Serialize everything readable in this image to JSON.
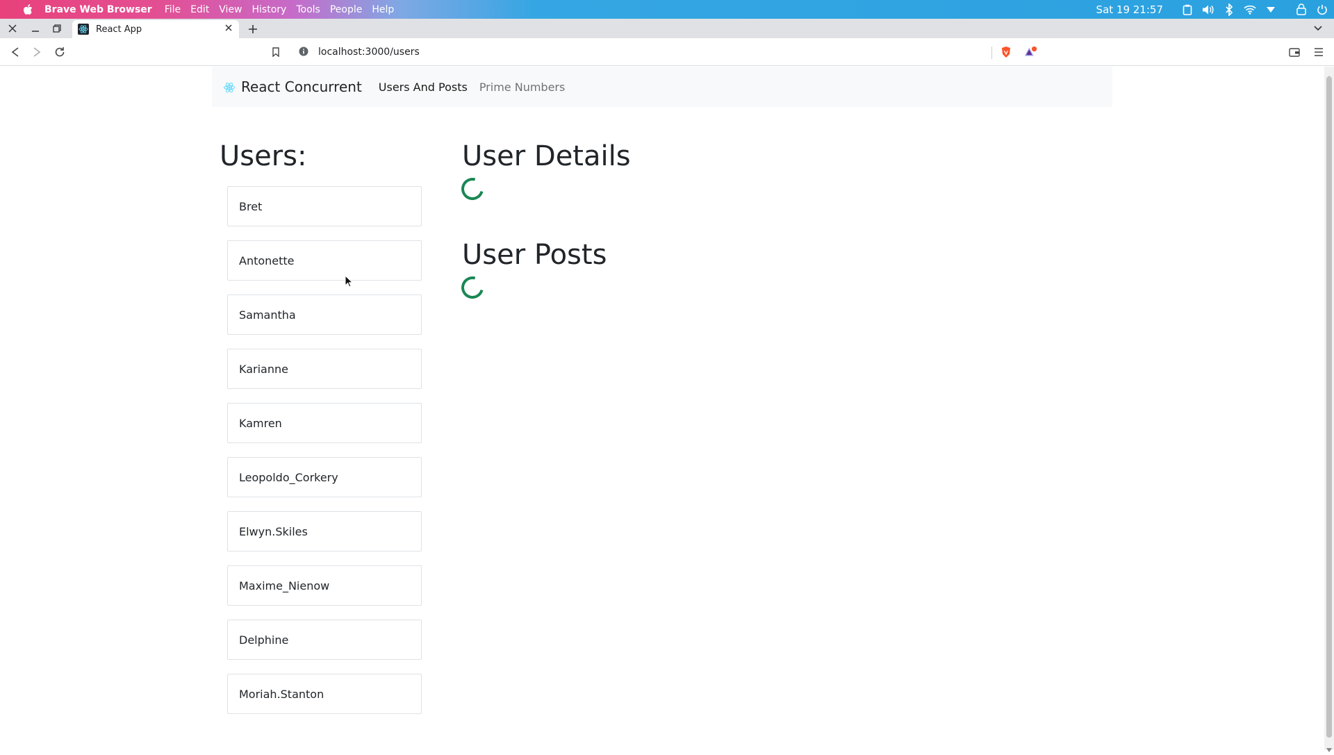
{
  "system_bar": {
    "app_name": "Brave Web Browser",
    "menus": [
      "File",
      "Edit",
      "View",
      "History",
      "Tools",
      "People",
      "Help"
    ],
    "clock": "Sat 19 21:57"
  },
  "browser": {
    "tab_title": "React App",
    "url": "localhost:3000/users"
  },
  "navbar": {
    "brand": "React Concurrent",
    "links": [
      "Users And Posts",
      "Prime Numbers"
    ]
  },
  "users": {
    "title": "Users:",
    "items": [
      "Bret",
      "Antonette",
      "Samantha",
      "Karianne",
      "Kamren",
      "Leopoldo_Corkery",
      "Elwyn.Skiles",
      "Maxime_Nienow",
      "Delphine",
      "Moriah.Stanton"
    ]
  },
  "details": {
    "title": "User Details"
  },
  "posts": {
    "title": "User Posts"
  },
  "colors": {
    "spinner": "#198754",
    "navbar_bg": "#f8f9fa"
  }
}
